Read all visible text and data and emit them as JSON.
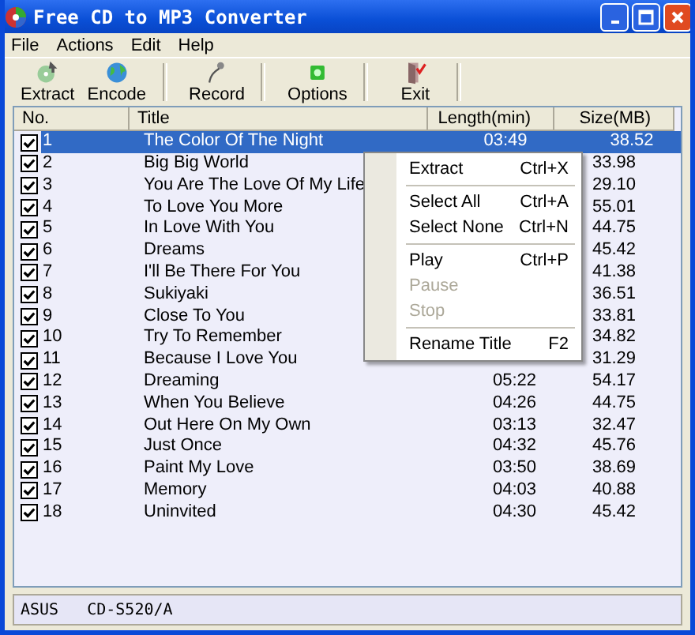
{
  "window": {
    "title": "Free CD to MP3 Converter"
  },
  "menu": [
    {
      "label": "File"
    },
    {
      "label": "Actions"
    },
    {
      "label": "Edit"
    },
    {
      "label": "Help"
    }
  ],
  "toolbar": [
    {
      "label": "Extract",
      "kind": "extract"
    },
    {
      "label": "Encode",
      "kind": "encode"
    },
    {
      "kind": "separator"
    },
    {
      "label": "Record",
      "kind": "record"
    },
    {
      "kind": "separator"
    },
    {
      "label": "Options",
      "kind": "options"
    },
    {
      "kind": "separator"
    },
    {
      "label": "Exit",
      "kind": "exit"
    },
    {
      "kind": "separator"
    }
  ],
  "table": {
    "columns": [
      "No.",
      "Title",
      "Length(min)",
      "Size(MB)"
    ],
    "rows": [
      {
        "no": "1",
        "title": "The Color Of The Night",
        "length": "03:49",
        "size": "38.52",
        "checked": true,
        "selected": true
      },
      {
        "no": "2",
        "title": "Big Big World",
        "size": "33.98",
        "checked": true,
        "selected": false
      },
      {
        "no": "3",
        "title": "You Are The Love Of My Life",
        "size": "29.10",
        "checked": true,
        "selected": false
      },
      {
        "no": "4",
        "title": "To Love You More",
        "size": "55.01",
        "checked": true,
        "selected": false
      },
      {
        "no": "5",
        "title": "In Love With You",
        "size": "44.75",
        "checked": true,
        "selected": false
      },
      {
        "no": "6",
        "title": "Dreams",
        "size": "45.42",
        "checked": true,
        "selected": false
      },
      {
        "no": "7",
        "title": "I'll Be There For You",
        "size": "41.38",
        "checked": true,
        "selected": false
      },
      {
        "no": "8",
        "title": "Sukiyaki",
        "size": "36.51",
        "checked": true,
        "selected": false
      },
      {
        "no": "9",
        "title": "Close To You",
        "size": "33.81",
        "checked": true,
        "selected": false
      },
      {
        "no": "10",
        "title": "Try To Remember",
        "size": "34.82",
        "checked": true,
        "selected": false
      },
      {
        "no": "11",
        "title": "Because I Love You",
        "size": "31.29",
        "checked": true,
        "selected": false
      },
      {
        "no": "12",
        "title": "Dreaming",
        "length": "05:22",
        "size": "54.17",
        "checked": true,
        "selected": false
      },
      {
        "no": "13",
        "title": "When You Believe",
        "length": "04:26",
        "size": "44.75",
        "checked": true,
        "selected": false
      },
      {
        "no": "14",
        "title": "Out Here On My Own",
        "length": "03:13",
        "size": "32.47",
        "checked": true,
        "selected": false
      },
      {
        "no": "15",
        "title": "Just Once",
        "length": "04:32",
        "size": "45.76",
        "checked": true,
        "selected": false
      },
      {
        "no": "16",
        "title": "Paint My Love",
        "length": "03:50",
        "size": "38.69",
        "checked": true,
        "selected": false
      },
      {
        "no": "17",
        "title": "Memory",
        "length": "04:03",
        "size": "40.88",
        "checked": true,
        "selected": false
      },
      {
        "no": "18",
        "title": "Uninvited",
        "length": "04:30",
        "size": "45.42",
        "checked": true,
        "selected": false
      }
    ]
  },
  "context_menu": [
    {
      "kind": "item",
      "label": "Extract",
      "shortcut": "Ctrl+X",
      "disabled": false
    },
    {
      "kind": "separator"
    },
    {
      "kind": "item",
      "label": "Select All",
      "shortcut": "Ctrl+A",
      "disabled": false
    },
    {
      "kind": "item",
      "label": "Select None",
      "shortcut": "Ctrl+N",
      "disabled": false
    },
    {
      "kind": "separator"
    },
    {
      "kind": "item",
      "label": "Play",
      "shortcut": "Ctrl+P",
      "disabled": false
    },
    {
      "kind": "item",
      "label": "Pause",
      "disabled": true
    },
    {
      "kind": "item",
      "label": "Stop",
      "disabled": true
    },
    {
      "kind": "separator"
    },
    {
      "kind": "item",
      "label": "Rename Title",
      "shortcut": "F2",
      "disabled": false
    }
  ],
  "status_bar": [
    {
      "text": "ASUS"
    },
    {
      "text": "CD-S520/A"
    }
  ]
}
